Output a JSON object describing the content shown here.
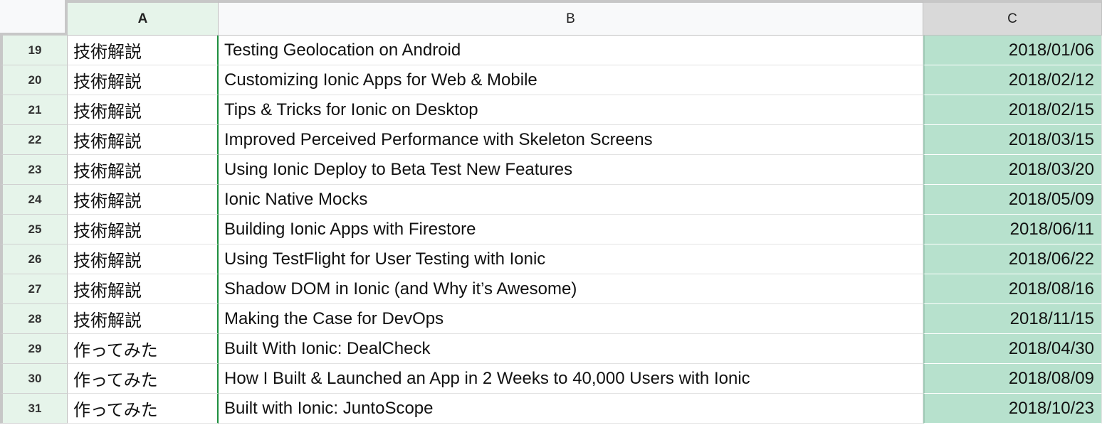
{
  "columns": [
    "A",
    "B",
    "C"
  ],
  "rows": [
    {
      "num": "19",
      "a": "技術解説",
      "b": "Testing Geolocation on Android",
      "c": "2018/01/06"
    },
    {
      "num": "20",
      "a": "技術解説",
      "b": "Customizing Ionic Apps for Web & Mobile",
      "c": "2018/02/12"
    },
    {
      "num": "21",
      "a": "技術解説",
      "b": "Tips & Tricks for Ionic on Desktop",
      "c": "2018/02/15"
    },
    {
      "num": "22",
      "a": "技術解説",
      "b": "Improved Perceived Performance with Skeleton Screens",
      "c": "2018/03/15"
    },
    {
      "num": "23",
      "a": "技術解説",
      "b": "Using Ionic Deploy to Beta Test New Features",
      "c": "2018/03/20"
    },
    {
      "num": "24",
      "a": "技術解説",
      "b": "Ionic Native Mocks",
      "c": "2018/05/09"
    },
    {
      "num": "25",
      "a": "技術解説",
      "b": "Building Ionic Apps with Firestore",
      "c": "2018/06/11"
    },
    {
      "num": "26",
      "a": "技術解説",
      "b": "Using TestFlight for User Testing with Ionic",
      "c": "2018/06/22"
    },
    {
      "num": "27",
      "a": "技術解説",
      "b": "Shadow DOM in Ionic (and Why it’s Awesome)",
      "c": "2018/08/16"
    },
    {
      "num": "28",
      "a": "技術解説",
      "b": "Making the Case for DevOps",
      "c": "2018/11/15"
    },
    {
      "num": "29",
      "a": "作ってみた",
      "b": "Built With Ionic: DealCheck",
      "c": "2018/04/30"
    },
    {
      "num": "30",
      "a": "作ってみた",
      "b": "How I Built & Launched an App in 2 Weeks to 40,000 Users with Ionic",
      "c": "2018/08/09"
    },
    {
      "num": "31",
      "a": "作ってみた",
      "b": "Built with Ionic: JuntoScope",
      "c": "2018/10/23"
    }
  ],
  "colors": {
    "selected_header": "#e6f4ea",
    "highlight_column": "#b7e1cd",
    "selection_border": "#1e8e3e"
  }
}
